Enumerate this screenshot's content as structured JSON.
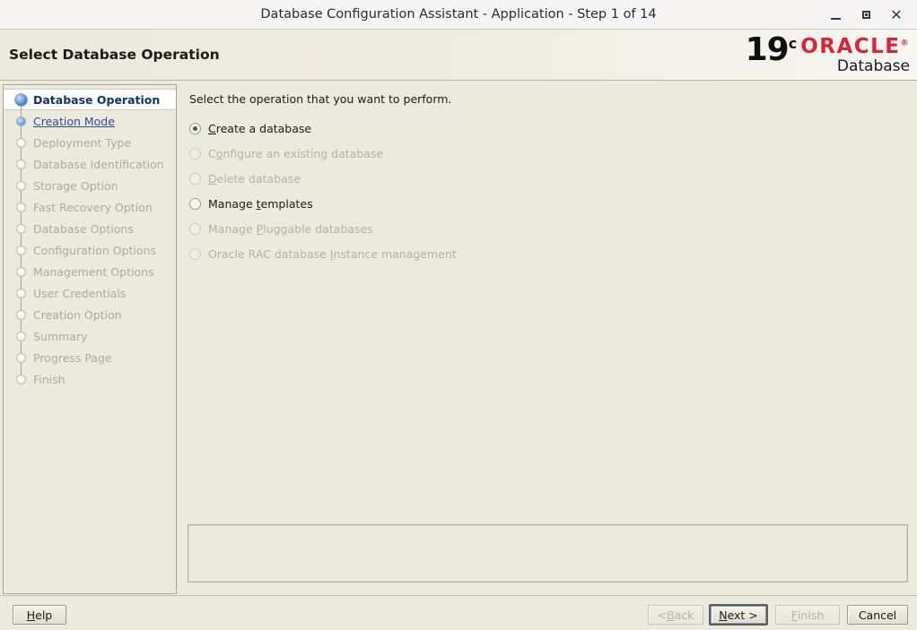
{
  "window": {
    "title": "Database Configuration Assistant - Application - Step 1 of 14",
    "controls": {
      "minimize": "minimize-icon",
      "maximize": "maximize-icon",
      "close": "✕"
    }
  },
  "header": {
    "page_title": "Select Database Operation",
    "logo": {
      "version": "19",
      "version_sup": "c",
      "brand": "ORACLE",
      "brand_sup": "®",
      "product": "Database",
      "brand_color": "#d8253a"
    }
  },
  "sidebar": {
    "items": [
      {
        "label": "Database Operation",
        "state": "active"
      },
      {
        "label": "Creation Mode",
        "state": "link"
      },
      {
        "label": "Deployment Type",
        "state": "disabled"
      },
      {
        "label": "Database Identification",
        "state": "disabled"
      },
      {
        "label": "Storage Option",
        "state": "disabled"
      },
      {
        "label": "Fast Recovery Option",
        "state": "disabled"
      },
      {
        "label": "Database Options",
        "state": "disabled"
      },
      {
        "label": "Configuration Options",
        "state": "disabled"
      },
      {
        "label": "Management Options",
        "state": "disabled"
      },
      {
        "label": "User Credentials",
        "state": "disabled"
      },
      {
        "label": "Creation Option",
        "state": "disabled"
      },
      {
        "label": "Summary",
        "state": "disabled"
      },
      {
        "label": "Progress Page",
        "state": "disabled"
      },
      {
        "label": "Finish",
        "state": "disabled"
      }
    ]
  },
  "main": {
    "instruction": "Select the operation that you want to perform.",
    "options": [
      {
        "label": "Create a database",
        "mnemonic": "C",
        "selected": true,
        "enabled": true
      },
      {
        "label": "Configure an existing database",
        "mnemonic": "o",
        "selected": false,
        "enabled": false
      },
      {
        "label": "Delete database",
        "mnemonic": "D",
        "selected": false,
        "enabled": false
      },
      {
        "label": "Manage templates",
        "mnemonic": "t",
        "selected": false,
        "enabled": true
      },
      {
        "label": "Manage Pluggable databases",
        "mnemonic": "P",
        "selected": false,
        "enabled": false
      },
      {
        "label": "Oracle RAC database Instance management",
        "mnemonic": "I",
        "selected": false,
        "enabled": false
      }
    ],
    "message_panel_text": ""
  },
  "footer": {
    "help": {
      "label": "Help",
      "mnemonic": "H",
      "enabled": true,
      "default": false
    },
    "back": {
      "label": "< Back",
      "mnemonic": "B",
      "enabled": false,
      "default": false
    },
    "next": {
      "label": "Next >",
      "mnemonic": "N",
      "enabled": true,
      "default": true
    },
    "finish": {
      "label": "Finish",
      "mnemonic": "F",
      "enabled": false,
      "default": false
    },
    "cancel": {
      "label": "Cancel",
      "mnemonic": "",
      "enabled": true,
      "default": false
    }
  }
}
